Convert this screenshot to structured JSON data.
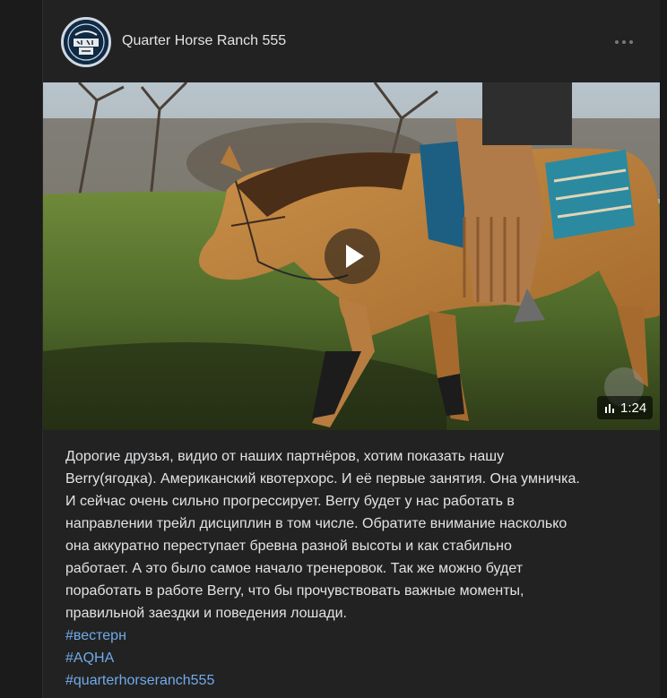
{
  "post": {
    "author": "Quarter Horse Ranch 555",
    "avatar_text": [
      "QUARTER HORSE",
      "RANCH",
      "555"
    ],
    "video": {
      "duration": "1:24",
      "play_icon": "play-icon",
      "stats_icon": "bar-chart-icon"
    },
    "body": [
      "Дорогие друзья, видио от наших партнёров, хотим показать нашу",
      "Berry(ягодка). Американский квотерхорс. И её первые занятия. Она умничка.",
      "И сейчас очень сильно прогрессирует. Berry будет у нас работать в",
      "направлении трейл дисциплин в том числе. Обратите внимание насколько",
      "она аккуратно переступает бревна разной высоты и как стабильно",
      "работает. А это было самое начало тренеровок. Так же можно будет",
      "поработать в работе Berry, что бы прочувствовать важные моменты,",
      "правильной заездки и поведения лошади."
    ],
    "hashtags": [
      "#вестерн",
      "#AQHA",
      "#quarterhorseranch555"
    ]
  },
  "colors": {
    "background": "#141414",
    "card": "#222222",
    "link": "#71aaeb",
    "text": "#e1e3e6"
  }
}
